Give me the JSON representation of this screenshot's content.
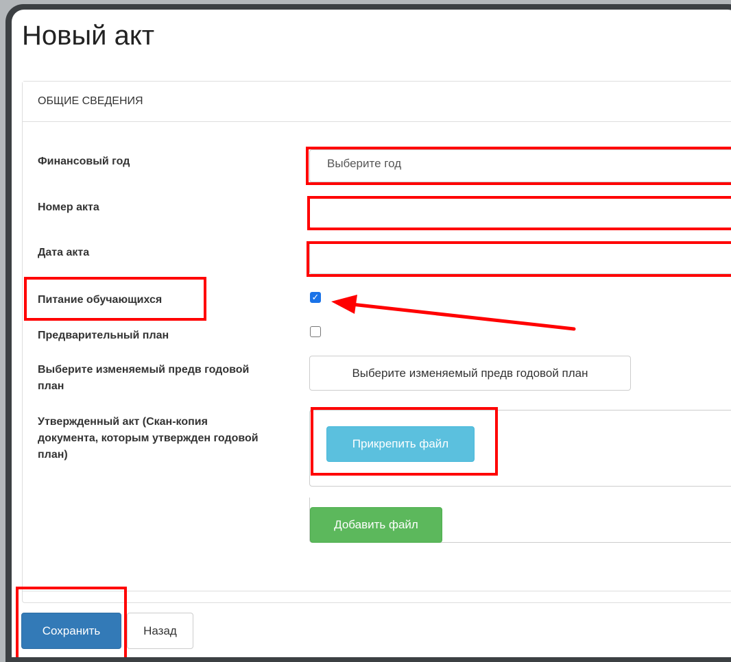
{
  "page": {
    "title": "Новый акт"
  },
  "panel": {
    "heading": "ОБЩИЕ СВЕДЕНИЯ"
  },
  "form": {
    "fiscal_year_label": "Финансовый год",
    "fiscal_year_value": "Выберите год",
    "act_number_label": "Номер акта",
    "act_number_value": "",
    "act_date_label": "Дата акта",
    "act_date_value": "",
    "student_meals_label": "Питание обучающихся",
    "student_meals_checked": true,
    "preliminary_plan_label": "Предварительный план",
    "preliminary_plan_checked": false,
    "select_plan_label": "Выберите изменяемый предв годовой план",
    "select_plan_button": "Выберите изменяемый предв годовой план",
    "approved_act_label": "Утвержденный акт (Скан-копия документа, которым утвержден годовой план)",
    "attach_file_button": "Прикрепить файл",
    "add_file_button": "Добавить файл"
  },
  "footer": {
    "save_button": "Сохранить",
    "back_button": "Назад"
  },
  "colors": {
    "annotation": "#ff0000",
    "primary": "#337ab7",
    "info": "#5bc0de",
    "success": "#5cb85c",
    "checkbox": "#1a73e8"
  }
}
